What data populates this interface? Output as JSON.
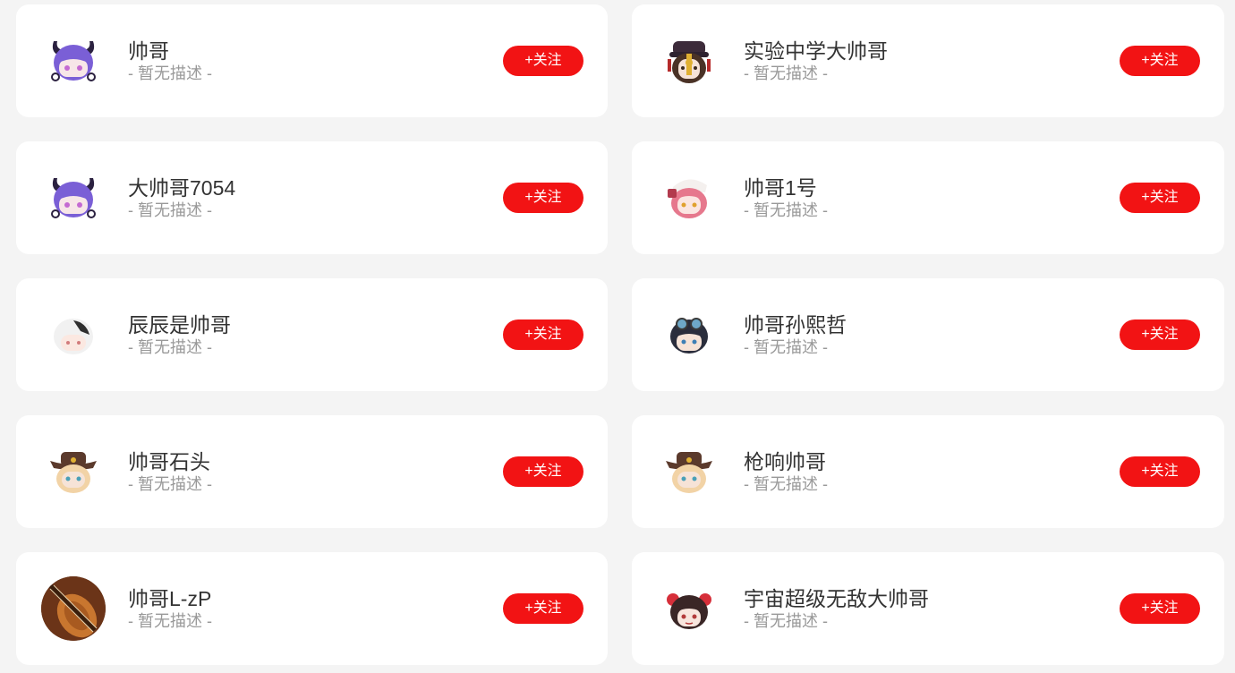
{
  "users": [
    {
      "name": "帅哥",
      "desc": "- 暂无描述 -",
      "follow_label": "+关注",
      "avatar_icon": "purple-horned-girl-avatar",
      "avatar_palette": [
        "#7a5fd6",
        "#2b2140",
        "#f7e6e8"
      ]
    },
    {
      "name": "实验中学大帅哥",
      "desc": "- 暂无描述 -",
      "follow_label": "+关注",
      "avatar_icon": "hat-girl-avatar",
      "avatar_palette": [
        "#3c2b3a",
        "#e0b032",
        "#f6e3d7"
      ]
    },
    {
      "name": "大帅哥7054",
      "desc": "- 暂无描述 -",
      "follow_label": "+关注",
      "avatar_icon": "purple-horned-girl-avatar",
      "avatar_palette": [
        "#7a5fd6",
        "#2b2140",
        "#f7e6e8"
      ]
    },
    {
      "name": "帅哥1号",
      "desc": "- 暂无描述 -",
      "follow_label": "+关注",
      "avatar_icon": "pink-hair-girl-avatar",
      "avatar_palette": [
        "#e6788d",
        "#b23a4d",
        "#fbe6e2"
      ]
    },
    {
      "name": "辰辰是帅哥",
      "desc": "- 暂无描述 -",
      "follow_label": "+关注",
      "avatar_icon": "white-hair-boy-avatar",
      "avatar_palette": [
        "#f1f1f1",
        "#2f2f2f",
        "#fbe8e1"
      ]
    },
    {
      "name": "帅哥孙熙哲",
      "desc": "- 暂无描述 -",
      "follow_label": "+关注",
      "avatar_icon": "goggles-boy-avatar",
      "avatar_palette": [
        "#2a2d3c",
        "#6ea8c8",
        "#f6e3d7"
      ]
    },
    {
      "name": "帅哥石头",
      "desc": "- 暂无描述 -",
      "follow_label": "+关注",
      "avatar_icon": "cowboy-hat-avatar",
      "avatar_palette": [
        "#5b3a2c",
        "#f2d3a6",
        "#f6e3d7"
      ]
    },
    {
      "name": "枪响帅哥",
      "desc": "- 暂无描述 -",
      "follow_label": "+关注",
      "avatar_icon": "cowboy-hat-avatar",
      "avatar_palette": [
        "#5b3a2c",
        "#f2d3a6",
        "#f6e3d7"
      ]
    },
    {
      "name": "帅哥L-zP",
      "desc": "- 暂无描述 -",
      "follow_label": "+关注",
      "avatar_icon": "violin-photo-avatar",
      "avatar_palette": [
        "#7a3a17",
        "#c8762f",
        "#3a1e0c"
      ]
    },
    {
      "name": "宇宙超级无敌大帅哥",
      "desc": "- 暂无描述 -",
      "follow_label": "+关注",
      "avatar_icon": "buns-girl-avatar",
      "avatar_palette": [
        "#3a2626",
        "#d62f3a",
        "#f8e5dd"
      ]
    }
  ],
  "colors": {
    "page_background": "#f4f4f4",
    "card_background": "#ffffff",
    "name_text": "#333333",
    "desc_text": "#999999",
    "follow_button": "#f21314",
    "follow_text": "#ffffff"
  }
}
